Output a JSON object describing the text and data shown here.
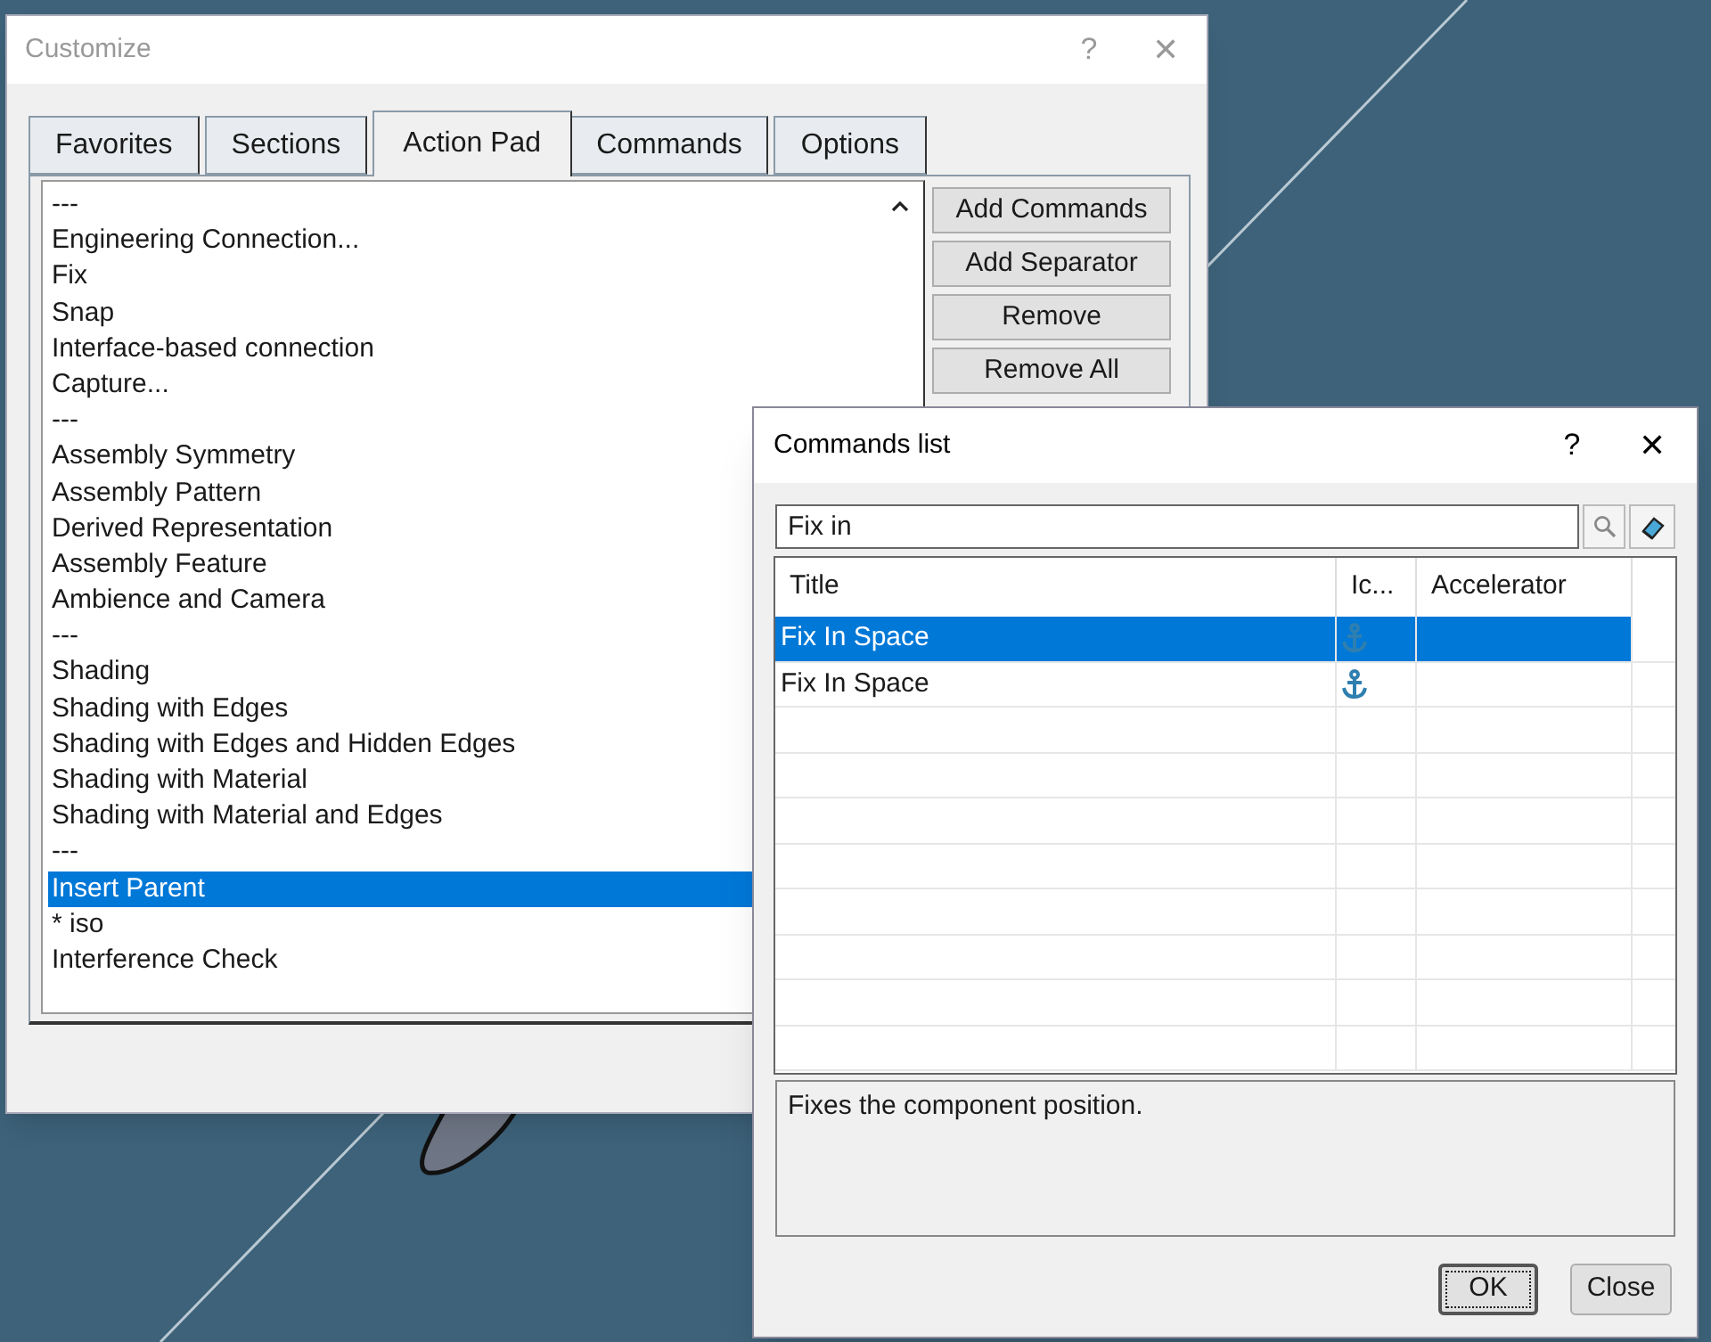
{
  "customize": {
    "title": "Customize",
    "help": "?",
    "close": "✕",
    "tabs": [
      {
        "label": "Favorites",
        "selected": false
      },
      {
        "label": "Sections",
        "selected": false
      },
      {
        "label": "Action Pad",
        "selected": true
      },
      {
        "label": "Commands",
        "selected": false
      },
      {
        "label": "Options",
        "selected": false
      }
    ],
    "items": [
      {
        "label": "---",
        "selected": false
      },
      {
        "label": "Engineering Connection...",
        "selected": false
      },
      {
        "label": "Fix",
        "selected": false
      },
      {
        "label": "Snap",
        "selected": false
      },
      {
        "label": "Interface-based connection",
        "selected": false
      },
      {
        "label": "Capture...",
        "selected": false
      },
      {
        "label": "---",
        "selected": false
      },
      {
        "label": "Assembly Symmetry",
        "selected": false
      },
      {
        "label": "Assembly Pattern",
        "selected": false
      },
      {
        "label": "Derived Representation",
        "selected": false
      },
      {
        "label": "Assembly Feature",
        "selected": false
      },
      {
        "label": "Ambience and Camera",
        "selected": false
      },
      {
        "label": "---",
        "selected": false
      },
      {
        "label": "Shading",
        "selected": false
      },
      {
        "label": "Shading with Edges",
        "selected": false
      },
      {
        "label": "Shading with Edges and Hidden Edges",
        "selected": false
      },
      {
        "label": "Shading with Material",
        "selected": false
      },
      {
        "label": "Shading with Material and Edges",
        "selected": false
      },
      {
        "label": "---",
        "selected": false
      },
      {
        "label": "Insert Parent",
        "selected": true
      },
      {
        "label": "* iso",
        "selected": false
      },
      {
        "label": "Interference Check",
        "selected": false
      }
    ],
    "buttons": [
      "Add Commands",
      "Add Separator",
      "Remove",
      "Remove All"
    ]
  },
  "commands_list": {
    "title": "Commands list",
    "help": "?",
    "close": "✕",
    "search": {
      "value": "Fix in"
    },
    "columns": [
      "Title",
      "Ic...",
      "Accelerator"
    ],
    "rows": [
      {
        "title": "Fix In Space",
        "selected": true
      },
      {
        "title": "Fix In Space",
        "selected": false
      }
    ],
    "description": "Fixes the component position.",
    "buttons": [
      "OK",
      "Close"
    ]
  }
}
